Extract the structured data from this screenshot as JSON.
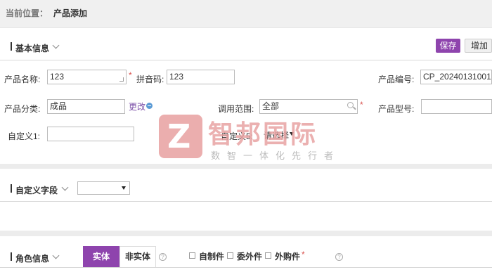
{
  "breadcrumb": {
    "label": "当前位置：",
    "current": "产品添加"
  },
  "basic_section": {
    "title": "基本信息",
    "save_label": "保存",
    "add_label": "增加"
  },
  "fields": {
    "product_name": {
      "label": "产品名称:",
      "value": "123"
    },
    "pinyin": {
      "label": "拼音码:",
      "value": "123"
    },
    "product_code": {
      "label": "产品编号:",
      "value": "CP_20240131001"
    },
    "category": {
      "label": "产品分类:",
      "value": "成品",
      "change_link": "更改"
    },
    "scope": {
      "label": "调用范围:",
      "value": "全部"
    },
    "model": {
      "label": "产品型号:",
      "value": ""
    },
    "custom1": {
      "label": "自定义1:",
      "value": ""
    },
    "custom5": {
      "label": "自定义5:",
      "value": "请选择"
    }
  },
  "custom_section": {
    "title": "自定义字段",
    "select_value": ""
  },
  "role_section": {
    "title": "角色信息",
    "tabs": [
      "实体",
      "非实体"
    ],
    "active_tab": 0,
    "checkboxes": [
      "自制件",
      "委外件",
      "外购件"
    ]
  },
  "watermark": {
    "title": "智邦国际",
    "subtitle": "数智一体化先行者",
    "logo_letter": "Z"
  },
  "colors": {
    "accent": "#8e44ad",
    "required": "#d9534f",
    "link": "#7b4fa8",
    "band": "#ececec"
  },
  "icons": {
    "collapse": "chevron-down-icon",
    "search": "search-icon",
    "help": "help-icon",
    "add": "add-circle-icon"
  },
  "required_mark": "*",
  "help_glyph": "?"
}
